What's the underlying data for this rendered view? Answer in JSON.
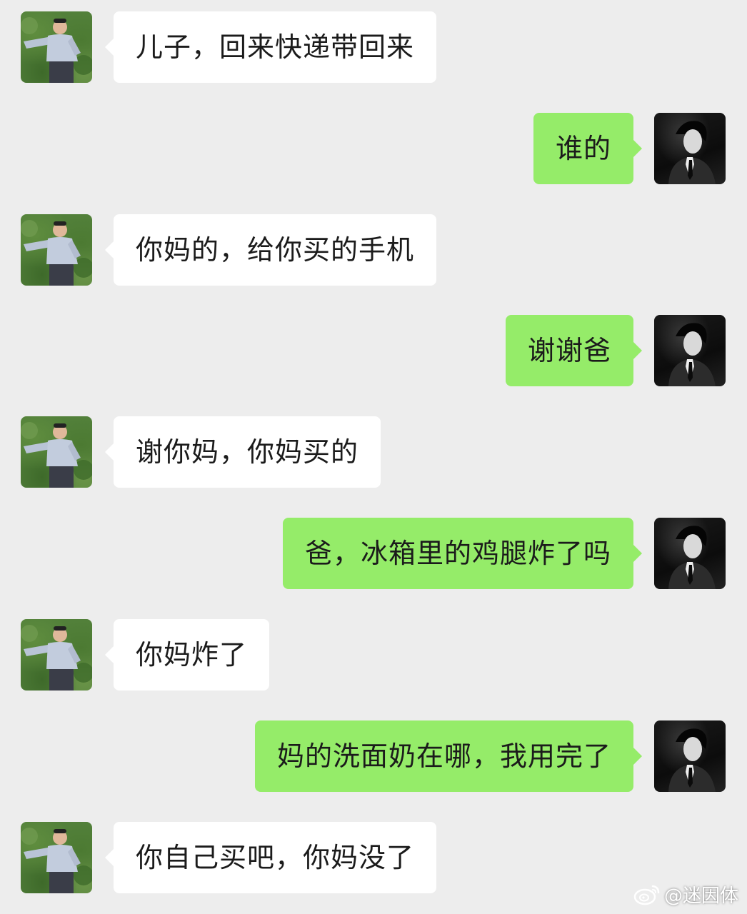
{
  "chat": {
    "messages": [
      {
        "side": "left",
        "sender": "dad",
        "text": "儿子，回来快递带回来"
      },
      {
        "side": "right",
        "sender": "son",
        "text": "谁的"
      },
      {
        "side": "left",
        "sender": "dad",
        "text": "你妈的，给你买的手机"
      },
      {
        "side": "right",
        "sender": "son",
        "text": "谢谢爸"
      },
      {
        "side": "left",
        "sender": "dad",
        "text": "谢你妈，你妈买的"
      },
      {
        "side": "right",
        "sender": "son",
        "text": "爸，冰箱里的鸡腿炸了吗"
      },
      {
        "side": "left",
        "sender": "dad",
        "text": "你妈炸了"
      },
      {
        "side": "right",
        "sender": "son",
        "text": "妈的洗面奶在哪，我用完了"
      },
      {
        "side": "left",
        "sender": "dad",
        "text": "你自己买吧，你妈没了"
      }
    ]
  },
  "watermark": {
    "icon": "weibo-icon",
    "text": "@迷因体"
  },
  "colors": {
    "background": "#ededed",
    "incoming_bubble": "#ffffff",
    "outgoing_bubble": "#95ec69",
    "text": "#1b1b1b"
  }
}
